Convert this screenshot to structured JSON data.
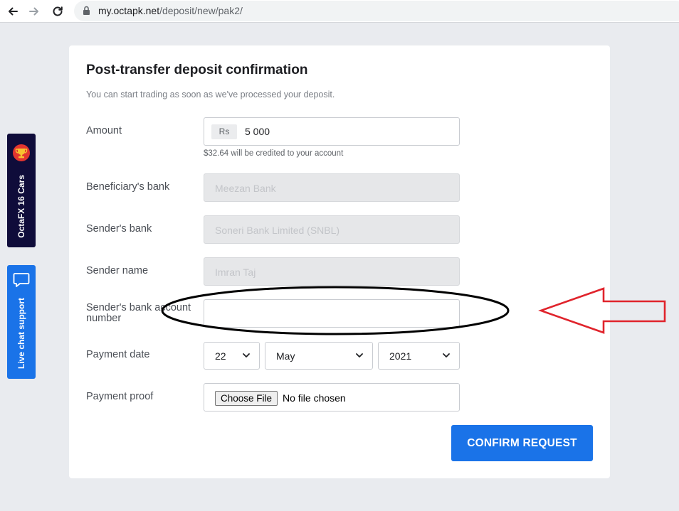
{
  "browser": {
    "url_host": "my.octapk.net",
    "url_path": "/deposit/new/pak2/"
  },
  "side_tabs": {
    "contest_label": "OctaFX 16 Cars",
    "chat_label": "Live chat support"
  },
  "page": {
    "title": "Post-transfer deposit confirmation",
    "subtitle": "You can start trading as soon as we've processed your deposit."
  },
  "form": {
    "amount": {
      "label": "Amount",
      "currency": "Rs",
      "value": "5 000",
      "helper": "$32.64 will be credited to your account"
    },
    "beneficiary_bank": {
      "label": "Beneficiary's bank",
      "value": "Meezan Bank"
    },
    "sender_bank": {
      "label": "Sender's bank",
      "value": "Soneri Bank Limited (SNBL)"
    },
    "sender_name": {
      "label": "Sender name",
      "value": "Imran Taj"
    },
    "sender_account": {
      "label_line1": "Sender's bank account",
      "label_line2": "number",
      "value": ""
    },
    "payment_date": {
      "label": "Payment date",
      "day": "22",
      "month": "May",
      "year": "2021"
    },
    "payment_proof": {
      "label": "Payment proof",
      "button": "Choose File",
      "status": "No file chosen"
    },
    "confirm_label": "CONFIRM REQUEST"
  },
  "colors": {
    "accent": "#1a73e8",
    "contest_tab": "#0f0c3a",
    "annotation_arrow": "#e0242c",
    "annotation_ellipse": "#000000"
  },
  "annotations": {
    "ellipse": "black ellipse around sender account number field",
    "arrow": "red outlined arrow pointing left at the field"
  }
}
